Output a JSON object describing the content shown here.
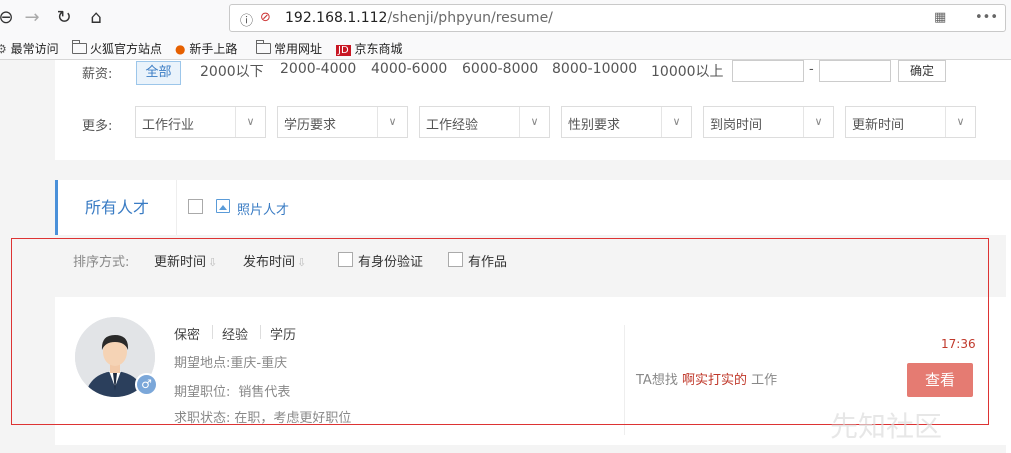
{
  "browser": {
    "url_host": "192.168.1.112",
    "url_path": "/shenji/phpyun/resume/",
    "bookmarks": [
      "最常访问",
      "火狐官方站点",
      "新手上路",
      "常用网址",
      "京东商城"
    ]
  },
  "filters": {
    "salary_label": "薪资:",
    "salary_options": [
      "全部",
      "2000以下",
      "2000-4000",
      "4000-6000",
      "6000-8000",
      "8000-10000",
      "10000以上"
    ],
    "salary_range_dash": "-",
    "confirm": "确定",
    "more_label": "更多:",
    "selects": [
      "工作行业",
      "学历要求",
      "工作经验",
      "性别要求",
      "到岗时间",
      "更新时间"
    ]
  },
  "tabs": {
    "active": "所有人才",
    "photo_only": "照片人才"
  },
  "sort": {
    "label": "排序方式:",
    "update_time": "更新时间",
    "publish_time": "发布时间",
    "id_verified": "有身份验证",
    "has_works": "有作品",
    "arrow": "⇩"
  },
  "resume": {
    "name": "保密",
    "experience": "经验",
    "education": "学历",
    "location_label": "期望地点:",
    "location": "重庆-重庆",
    "position_label": "期望职位:",
    "position": "销售代表",
    "status_label": "求职状态:",
    "status": "在职，考虑更好职位",
    "wants_prefix": "TA想找",
    "wants_keyword": "啊实打实的",
    "wants_suffix": "工作",
    "time": "17:36",
    "view_button": "查看"
  },
  "watermark": "先知社区",
  "colors": {
    "accent_blue": "#3a7cc4",
    "highlight_red": "#c0392b",
    "view_button": "#e57b72",
    "frame_red": "#dd3333"
  }
}
